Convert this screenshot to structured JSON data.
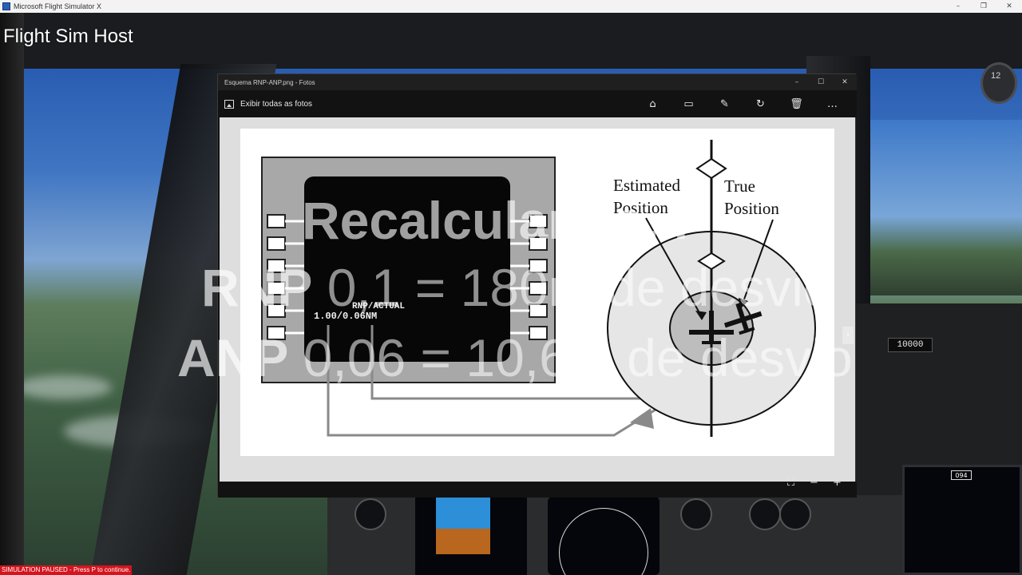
{
  "os_window": {
    "title": "Microsoft Flight Simulator X",
    "controls": [
      "–",
      "❐",
      "✕"
    ]
  },
  "stream": {
    "host_label": "Flight Sim Host",
    "sim_status": "SIMULATION PAUSED - Press P to continue.",
    "altitude_selector": "10000",
    "clock_label": "12"
  },
  "photos_app": {
    "title": "Esquema RNP-ANP.png - Fotos",
    "window_controls": [
      "–",
      "☐",
      "✕"
    ],
    "back_label": "Exibir todas as fotos",
    "tools": [
      {
        "name": "enhance",
        "glyph": "⌂"
      },
      {
        "name": "slideshow",
        "glyph": "▭"
      },
      {
        "name": "edit",
        "glyph": "✎"
      },
      {
        "name": "rotate",
        "glyph": "↻"
      },
      {
        "name": "delete",
        "glyph": "🗑"
      },
      {
        "name": "more",
        "glyph": "…"
      }
    ],
    "zoom_controls": [
      "⛶",
      "−",
      "+"
    ],
    "next_glyph": "›"
  },
  "figure": {
    "cdu_line1": "RNP/ACTUAL",
    "cdu_line2": "1.00/0.06NM",
    "estimated_position_line1": "Estimated",
    "estimated_position_line2": "Position",
    "true_position_line1": "True",
    "true_position_line2": "Position"
  },
  "overlay": {
    "line1": "Recalculando...",
    "line2_bold": "RNP",
    "line2_light": " 0,1 = 180m de desvio",
    "line3_bold": "ANP",
    "line3_light": " 0,06 = 10,6m de desvio"
  }
}
